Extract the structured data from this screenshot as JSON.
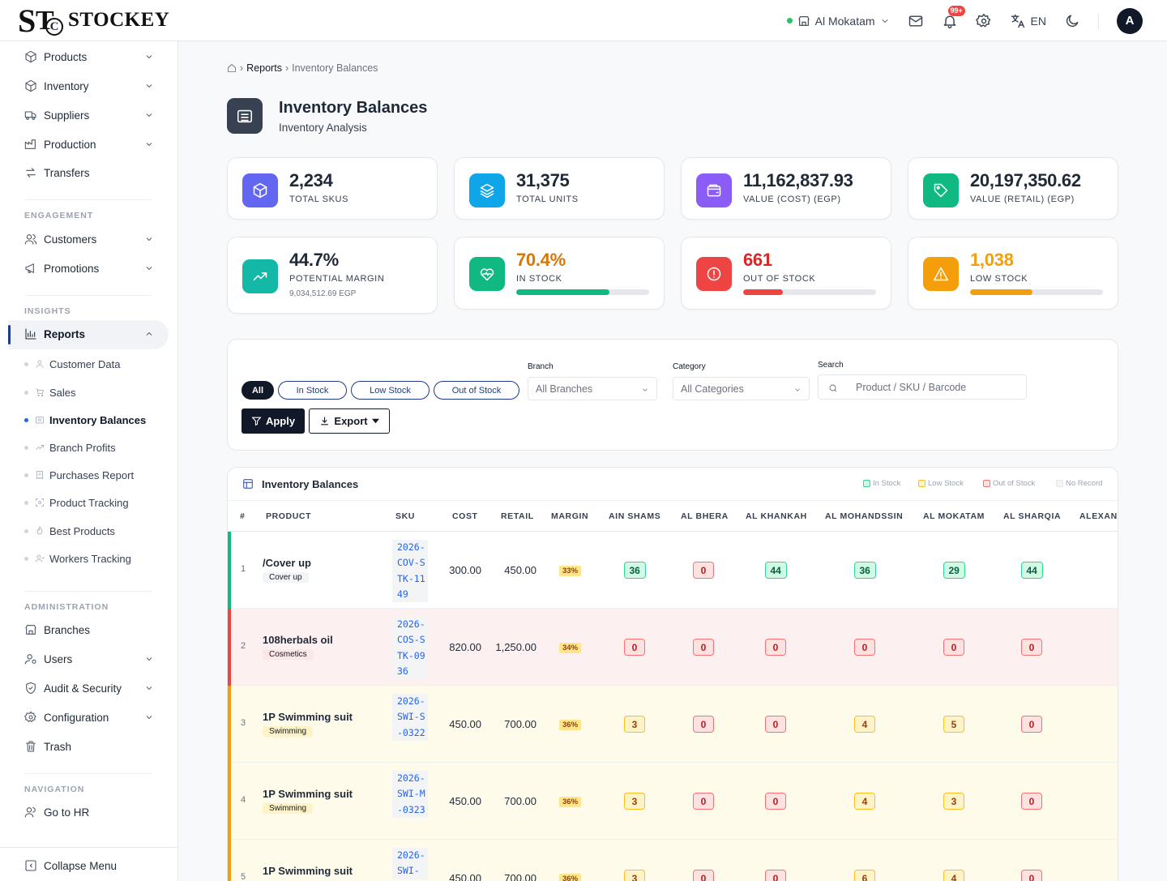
{
  "header": {
    "logo_text": "STOCKEY",
    "branch": "Al Mokatam",
    "notifications_badge": "99+",
    "language": "EN",
    "avatar_initial": "A"
  },
  "sidebar": {
    "top_items": [
      {
        "label": "Products",
        "icon": "package-icon",
        "has_chevron": true
      },
      {
        "label": "Inventory",
        "icon": "box-icon",
        "has_chevron": true
      },
      {
        "label": "Suppliers",
        "icon": "truck-icon",
        "has_chevron": true
      },
      {
        "label": "Production",
        "icon": "factory-icon",
        "has_chevron": true
      },
      {
        "label": "Transfers",
        "icon": "arrows-icon",
        "has_chevron": false
      }
    ],
    "engagement_label": "ENGAGEMENT",
    "engagement_items": [
      {
        "label": "Customers",
        "icon": "users-icon"
      },
      {
        "label": "Promotions",
        "icon": "megaphone-icon"
      }
    ],
    "insights_label": "INSIGHTS",
    "reports_label": "Reports",
    "report_items": [
      {
        "label": "Customer Data",
        "icon": "user-icon"
      },
      {
        "label": "Sales",
        "icon": "cart-icon"
      },
      {
        "label": "Inventory Balances",
        "icon": "warehouse-icon",
        "active": true
      },
      {
        "label": "Branch Profits",
        "icon": "trend-icon"
      },
      {
        "label": "Purchases Report",
        "icon": "receipt-icon"
      },
      {
        "label": "Product Tracking",
        "icon": "scan-icon"
      },
      {
        "label": "Best Products",
        "icon": "flame-icon"
      },
      {
        "label": "Workers Tracking",
        "icon": "worker-icon"
      }
    ],
    "admin_label": "ADMINISTRATION",
    "admin_items": [
      {
        "label": "Branches",
        "icon": "store-icon",
        "has_chevron": false
      },
      {
        "label": "Users",
        "icon": "user-cog-icon",
        "has_chevron": true
      },
      {
        "label": "Audit & Security",
        "icon": "shield-icon",
        "has_chevron": true
      },
      {
        "label": "Configuration",
        "icon": "gear-icon",
        "has_chevron": true
      },
      {
        "label": "Trash",
        "icon": "trash-icon",
        "has_chevron": false
      }
    ],
    "navigation_label": "NAVIGATION",
    "hr_label": "Go to HR",
    "collapse_label": "Collapse Menu"
  },
  "breadcrumb": {
    "parent": "Reports",
    "current": "Inventory Balances"
  },
  "page": {
    "title": "Inventory Balances",
    "subtitle": "Inventory Analysis"
  },
  "stats": [
    {
      "value": "2,234",
      "label": "TOTAL SKUS",
      "color": "#6366f1"
    },
    {
      "value": "31,375",
      "label": "TOTAL UNITS",
      "color": "#0ea5e9"
    },
    {
      "value": "11,162,837.93",
      "label": "VALUE (COST) (EGP)",
      "color": "#8b5cf6"
    },
    {
      "value": "20,197,350.62",
      "label": "VALUE (RETAIL) (EGP)",
      "color": "#10b981"
    },
    {
      "value": "44.7%",
      "label": "POTENTIAL MARGIN",
      "sub": "9,034,512.69 EGP",
      "color": "#14b8a6"
    },
    {
      "value": "70.4%",
      "label": "IN STOCK",
      "color": "#10b981",
      "value_color": "#d97706",
      "bar_fraction": 0.704,
      "bar_color": "#10b981"
    },
    {
      "value": "661",
      "label": "OUT OF STOCK",
      "color": "#ef4444",
      "value_color": "#dc2626",
      "bar_fraction": 0.3,
      "bar_color": "#ef4444"
    },
    {
      "value": "1,038",
      "label": "LOW STOCK",
      "color": "#f59e0b",
      "value_color": "#f59e0b",
      "bar_fraction": 0.47,
      "bar_color": "#f59e0b"
    }
  ],
  "filters": {
    "chips": [
      "All",
      "In Stock",
      "Low Stock",
      "Out of Stock"
    ],
    "branch_label": "Branch",
    "branch_value": "All Branches",
    "category_label": "Category",
    "category_value": "All Categories",
    "search_label": "Search",
    "search_placeholder": "Product / SKU / Barcode",
    "apply_label": "Apply",
    "export_label": "Export"
  },
  "table": {
    "title": "Inventory Balances",
    "legend": [
      "In Stock",
      "Low Stock",
      "Out of Stock",
      "No Record"
    ],
    "columns": [
      "#",
      "PRODUCT",
      "SKU",
      "COST",
      "RETAIL",
      "MARGIN",
      "AIN SHAMS",
      "AL BHERA",
      "AL KHANKAH",
      "AL MOHANDSSIN",
      "AL MOKATAM",
      "AL SHARQIA",
      "ALEXANI"
    ],
    "rows": [
      {
        "num": "1",
        "name": "/Cover up",
        "category": "Cover up",
        "sku": "2026-COV-STK-1149",
        "cost": "300.00",
        "retail": "450.00",
        "margin": "33%",
        "status": "in",
        "qty": [
          "36",
          "0",
          "44",
          "36",
          "29",
          "44"
        ]
      },
      {
        "num": "2",
        "name": "108herbals oil",
        "category": "Cosmetics",
        "sku": "2026-COS-STK-0936",
        "cost": "820.00",
        "retail": "1,250.00",
        "margin": "34%",
        "status": "out",
        "qty": [
          "0",
          "0",
          "0",
          "0",
          "0",
          "0"
        ]
      },
      {
        "num": "3",
        "name": "1P Swimming suit",
        "category": "Swimming",
        "sku": "2026-SWI-S-0322",
        "cost": "450.00",
        "retail": "700.00",
        "margin": "36%",
        "status": "low",
        "qty": [
          "3",
          "0",
          "0",
          "4",
          "5",
          "0"
        ]
      },
      {
        "num": "4",
        "name": "1P Swimming suit",
        "category": "Swimming",
        "sku": "2026-SWI-M-0323",
        "cost": "450.00",
        "retail": "700.00",
        "margin": "36%",
        "status": "low",
        "qty": [
          "3",
          "0",
          "0",
          "4",
          "3",
          "0"
        ]
      },
      {
        "num": "5",
        "name": "1P Swimming suit",
        "category": "",
        "sku": "2026-SWI-",
        "cost": "450.00",
        "retail": "700.00",
        "margin": "36%",
        "status": "low",
        "qty": [
          "3",
          "0",
          "0",
          "6",
          "4",
          "0"
        ]
      }
    ]
  }
}
